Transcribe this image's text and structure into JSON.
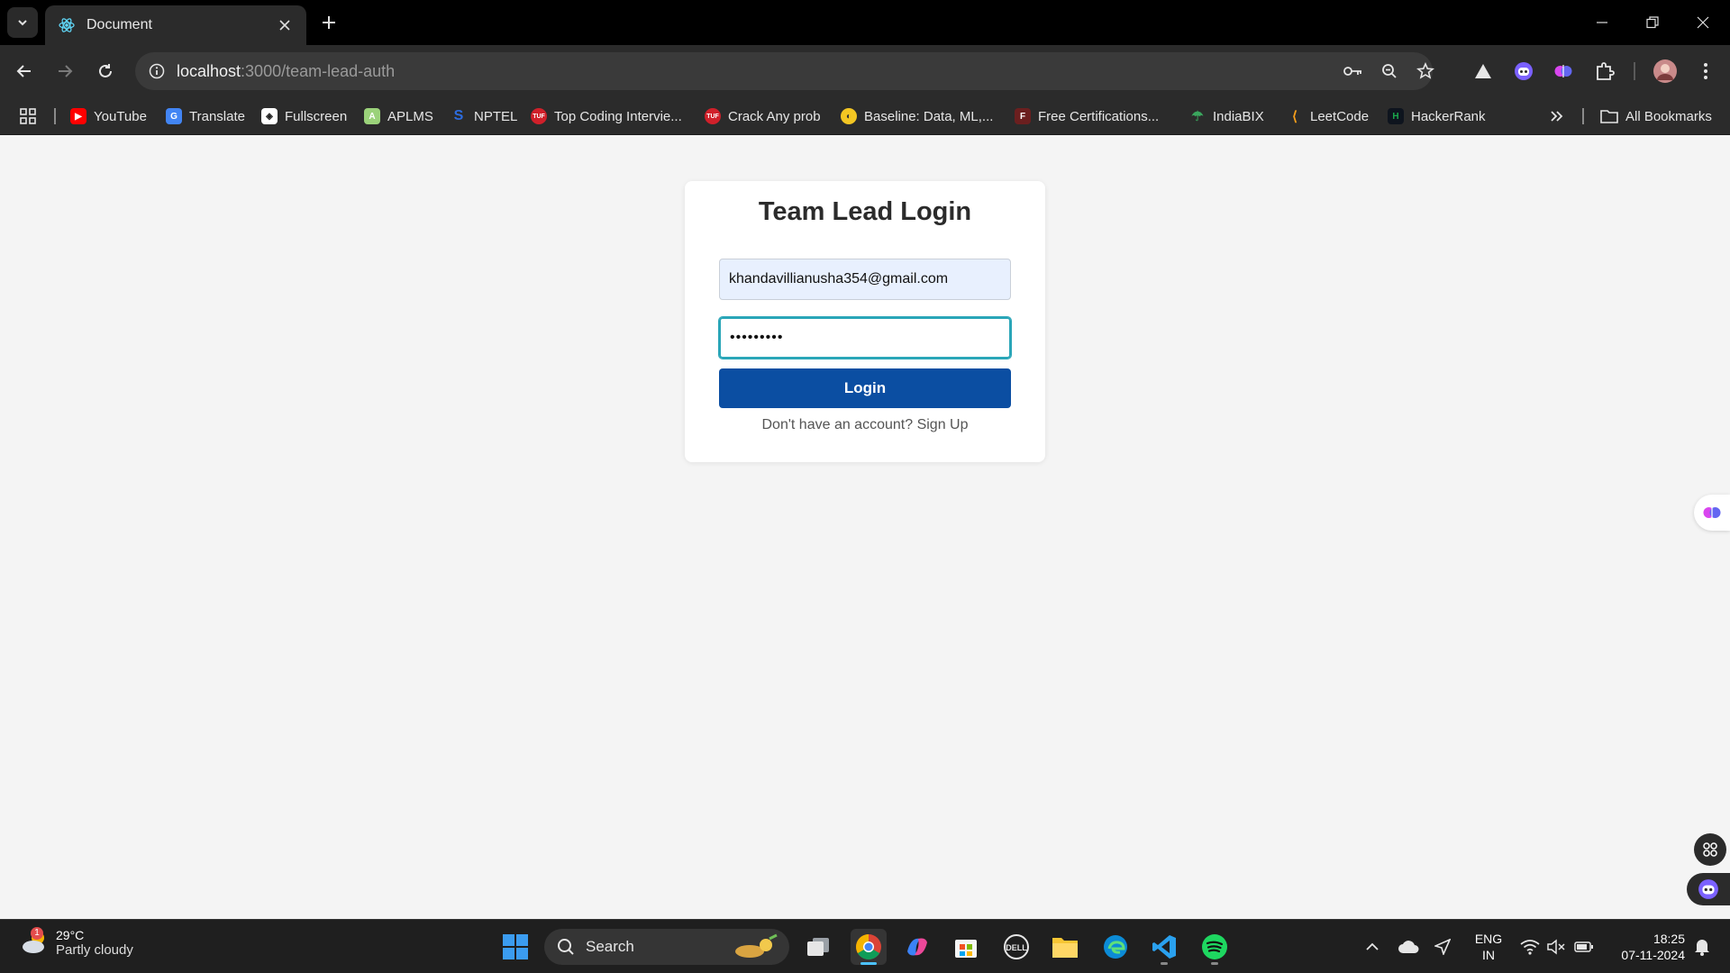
{
  "browser": {
    "tab_title": "Document",
    "url_host": "localhost",
    "url_path": ":3000/team-lead-auth"
  },
  "bookmarks": {
    "items": [
      {
        "label": "YouTube",
        "icon": "youtube-icon",
        "color": "#ff0000"
      },
      {
        "label": "Translate",
        "icon": "translate-icon",
        "color": "#4285f4"
      },
      {
        "label": "Fullscreen",
        "icon": "fullscreen-icon",
        "color": "#ffffff"
      },
      {
        "label": "APLMS",
        "icon": "aplms-icon",
        "color": "#9bd27a"
      },
      {
        "label": "NPTEL",
        "icon": "nptel-icon",
        "color": "#2d6cdf"
      },
      {
        "label": "Top Coding Intervie...",
        "icon": "tuf-icon",
        "color": "#d0202a"
      },
      {
        "label": "Crack Any prob",
        "icon": "tuf-icon",
        "color": "#d0202a"
      },
      {
        "label": "Baseline: Data, ML,...",
        "icon": "baseline-icon",
        "color": "#f3c623"
      },
      {
        "label": "Free Certifications...",
        "icon": "certifications-icon",
        "color": "#6b1f1f"
      },
      {
        "label": "IndiaBIX",
        "icon": "indiabix-icon",
        "color": "#3aa55d"
      },
      {
        "label": "LeetCode",
        "icon": "leetcode-icon",
        "color": "#f89f1b"
      },
      {
        "label": "HackerRank",
        "icon": "hackerrank-icon",
        "color": "#1ba94c"
      }
    ],
    "all_bookmarks": "All Bookmarks"
  },
  "login": {
    "title": "Team Lead Login",
    "email_value": "khandavillianusha354@gmail.com",
    "password_value": "password1",
    "button_label": "Login",
    "signup_text": "Don't have an account? Sign Up"
  },
  "taskbar": {
    "temperature": "29°C",
    "condition": "Partly cloudy",
    "weather_badge": "1",
    "search_label": "Search",
    "lang_line1": "ENG",
    "lang_line2": "IN",
    "time": "18:25",
    "date": "07-11-2024"
  },
  "colors": {
    "accent": "#0b4ea2",
    "focus_ring": "#2aa6b8",
    "autofill_bg": "#e8f0fe"
  }
}
